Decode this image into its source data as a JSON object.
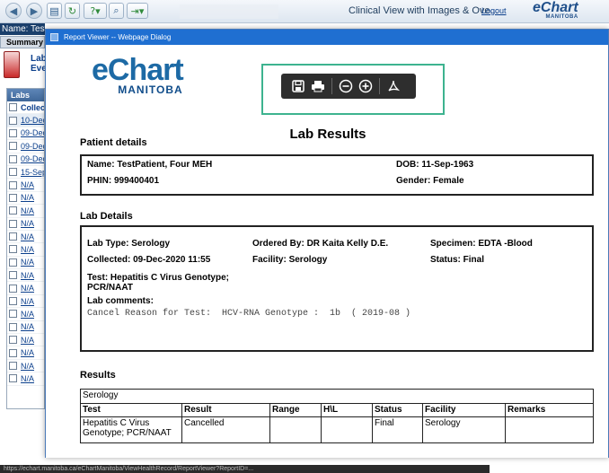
{
  "topbar": {
    "title": "Clinical View with Images & Ove...",
    "logout": "Logout",
    "logo_main": "eChart",
    "logo_sub": "MANITOBA"
  },
  "background": {
    "name_label": "Name: TestF",
    "summary_tab": "Summary ▾",
    "side_label_1": "Lab",
    "side_label_2": "Eve",
    "labs_header": "Labs",
    "column_header": "Collect",
    "rows": [
      "10-Dec",
      "09-Dec",
      "09-Dec",
      "09-Dec",
      "15-Sep",
      "N/A",
      "N/A",
      "N/A",
      "N/A",
      "N/A",
      "N/A",
      "N/A",
      "N/A",
      "N/A",
      "N/A",
      "N/A",
      "N/A",
      "N/A",
      "N/A",
      "N/A",
      "N/A"
    ]
  },
  "dialog": {
    "title": "Report Viewer -- Webpage Dialog",
    "logo_main": "eChart",
    "logo_sub": "MANITOBA",
    "report_title": "Lab Results",
    "toolbar": {
      "icons": [
        "save-icon",
        "print-icon",
        "zoom-out-icon",
        "zoom-in-icon",
        "pdf-icon"
      ]
    },
    "patient": {
      "section_label": "Patient details",
      "name": "Name: TestPatient, Four MEH",
      "phin": "PHIN: 999400401",
      "dob": "DOB: 11-Sep-1963",
      "gender": "Gender: Female"
    },
    "lab": {
      "section_label": "Lab Details",
      "lab_type": "Lab Type: Serology",
      "ordered_by": "Ordered By: DR Kaita Kelly D.E.",
      "specimen": "Specimen: EDTA -Blood",
      "collected": "Collected: 09-Dec-2020 11:55",
      "facility": "Facility: Serology",
      "status": "Status: Final",
      "test_line1": "Test: Hepatitis C Virus Genotype;",
      "test_line2": "PCR/NAAT",
      "comments_label": "Lab comments:",
      "comment": "Cancel Reason for Test:  HCV-RNA Genotype :  1b  ( 2019-08 )"
    },
    "results": {
      "section_label": "Results",
      "group": "Serology",
      "headers": [
        "Test",
        "Result",
        "Range",
        "H\\L",
        "Status",
        "Facility",
        "Remarks"
      ],
      "rows": [
        [
          "Hepatitis C Virus Genotype; PCR/NAAT",
          "Cancelled",
          "",
          "",
          "Final",
          "Serology",
          ""
        ]
      ]
    }
  },
  "statusbar": "https://echart.manitoba.ca/eChartManitoba/ViewHealthRecord/ReportViewer?ReportID=..."
}
